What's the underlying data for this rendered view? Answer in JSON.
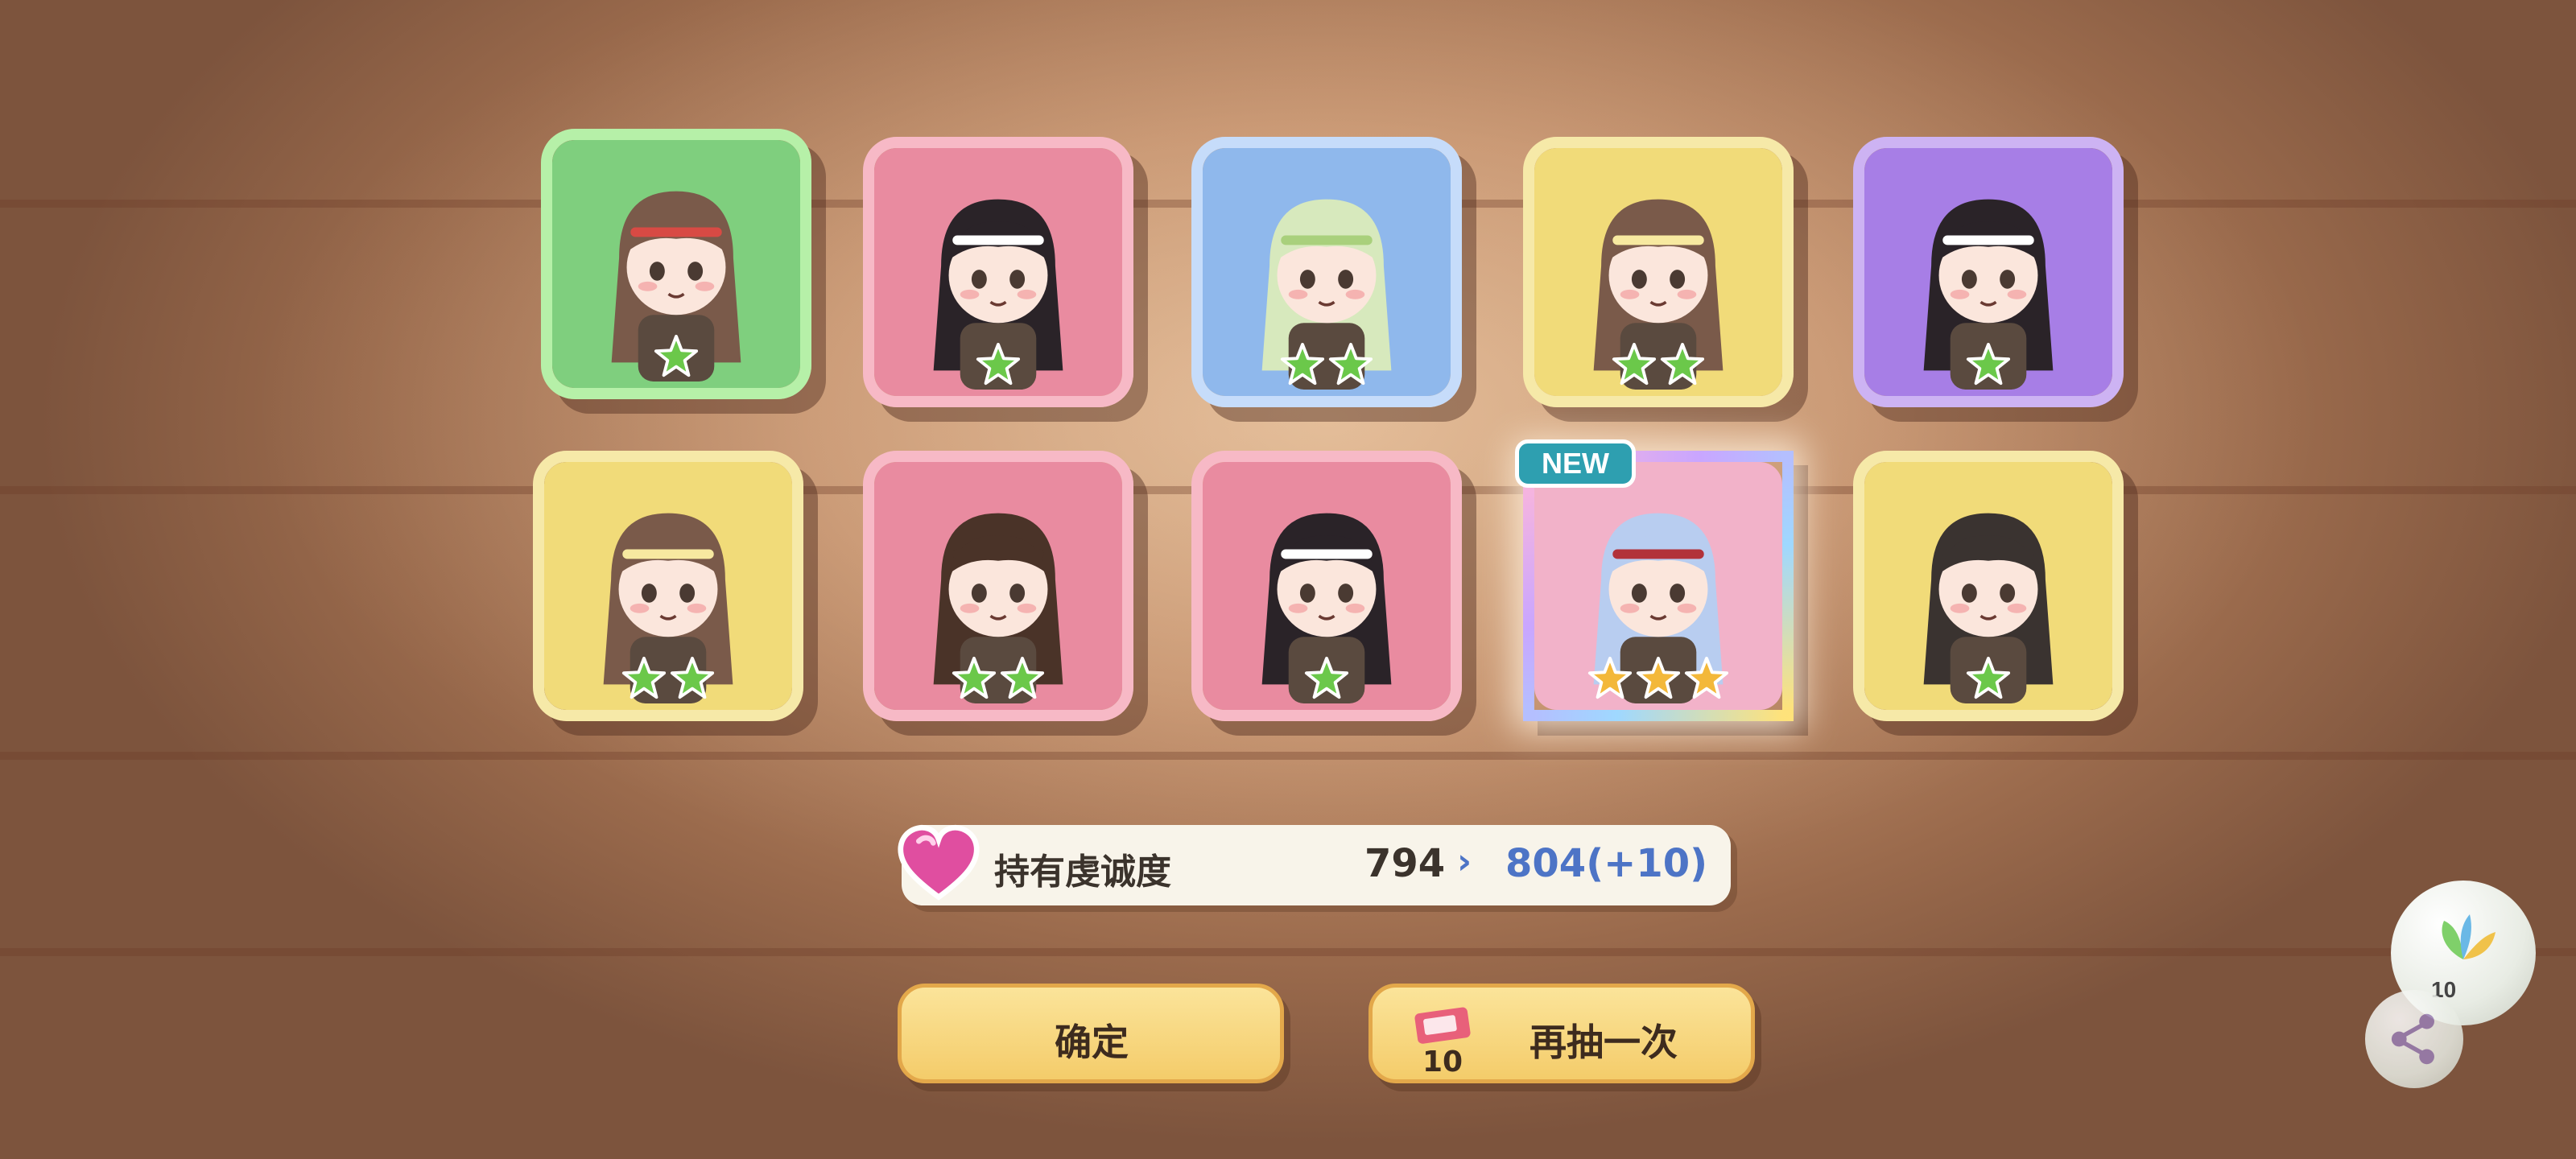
{
  "cards": [
    {
      "stars": 1,
      "bg": "#7fcf7e",
      "frame": "#b6f0a8",
      "new": false,
      "hair": "#7a5a4a",
      "band": "#d84a44"
    },
    {
      "stars": 1,
      "bg": "#e98ba0",
      "frame": "#f7b9c6",
      "new": false,
      "hair": "#2a2328",
      "band": "#ffffff"
    },
    {
      "stars": 2,
      "bg": "#8fb8ec",
      "frame": "#c6dcfa",
      "new": false,
      "hair": "#d7e9bd",
      "band": "#a9d07c"
    },
    {
      "stars": 2,
      "bg": "#f1db79",
      "frame": "#f6e9a8",
      "new": false,
      "hair": "#7a5a4a",
      "band": "#f7e9a0"
    },
    {
      "stars": 1,
      "bg": "#a77ee6",
      "frame": "#cdb3f3",
      "new": false,
      "hair": "#2a2328",
      "band": "#ffffff"
    },
    {
      "stars": 2,
      "bg": "#f1db79",
      "frame": "#f6e9a8",
      "new": false,
      "hair": "#7a5a4a",
      "band": "#f7e9a0"
    },
    {
      "stars": 2,
      "bg": "#e98ba0",
      "frame": "#f7b9c6",
      "new": false,
      "hair": "#4a3328",
      "band": "#4a3328"
    },
    {
      "stars": 1,
      "bg": "#e98ba0",
      "frame": "#f7b9c6",
      "new": false,
      "hair": "#2a2328",
      "band": "#ffffff"
    },
    {
      "stars": 3,
      "bg": "#f2b2c9",
      "frame": "#c8a8f6",
      "new": true,
      "hair": "#b8cdf0",
      "band": "#b2323a"
    },
    {
      "stars": 1,
      "bg": "#f1db79",
      "frame": "#f6e9a8",
      "new": false,
      "hair": "#3a3330",
      "band": "#3a3330"
    }
  ],
  "new_badge": "NEW",
  "devotion": {
    "label": "持有虔诚度",
    "current": "794",
    "arrow": "›",
    "next": "804(+10)"
  },
  "buttons": {
    "confirm": "确定",
    "again": "再抽一次",
    "ticket_count": "10"
  },
  "side": {
    "count": "10"
  },
  "colors": {
    "star_green": "#6bc84a",
    "star_gold": "#f3b83a",
    "accent_blue": "#4d74c6"
  }
}
